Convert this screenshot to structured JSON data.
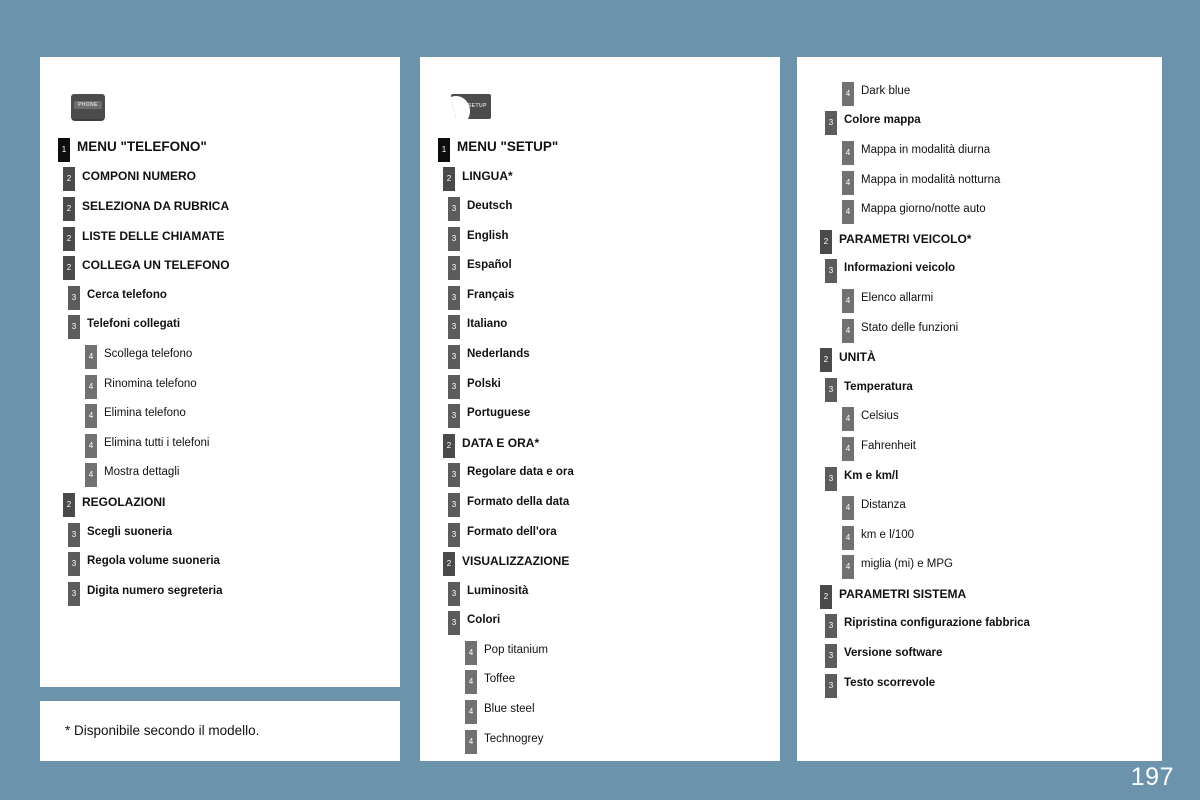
{
  "page": {
    "number": "197",
    "background_color": "#6b93ab"
  },
  "footnote": {
    "text": "* Disponibile secondo il modello."
  },
  "columns": [
    {
      "id": "col1",
      "icon": {
        "name": "phone-icon",
        "label": "PHONE"
      },
      "items": [
        {
          "level": 1,
          "label": "MENU \"TELEFONO\""
        },
        {
          "level": 2,
          "label": "COMPONI NUMERO"
        },
        {
          "level": 2,
          "label": "SELEZIONA DA RUBRICA"
        },
        {
          "level": 2,
          "label": "LISTE DELLE CHIAMATE"
        },
        {
          "level": 2,
          "label": "COLLEGA UN TELEFONO"
        },
        {
          "level": 3,
          "label": "Cerca telefono"
        },
        {
          "level": 3,
          "label": "Telefoni collegati"
        },
        {
          "level": 4,
          "label": "Scollega telefono"
        },
        {
          "level": 4,
          "label": "Rinomina telefono"
        },
        {
          "level": 4,
          "label": "Elimina telefono"
        },
        {
          "level": 4,
          "label": "Elimina tutti i telefoni"
        },
        {
          "level": 4,
          "label": "Mostra dettagli"
        },
        {
          "level": 2,
          "label": "REGOLAZIONI"
        },
        {
          "level": 3,
          "label": "Scegli suoneria"
        },
        {
          "level": 3,
          "label": "Regola volume suoneria"
        },
        {
          "level": 3,
          "label": "Digita numero segreteria"
        }
      ]
    },
    {
      "id": "col2",
      "icon": {
        "name": "setup-icon",
        "label": "SETUP"
      },
      "items": [
        {
          "level": 1,
          "label": "MENU \"SETUP\""
        },
        {
          "level": 2,
          "label": "LINGUA*"
        },
        {
          "level": 3,
          "label": "Deutsch"
        },
        {
          "level": 3,
          "label": "English"
        },
        {
          "level": 3,
          "label": "Español"
        },
        {
          "level": 3,
          "label": "Français"
        },
        {
          "level": 3,
          "label": "Italiano"
        },
        {
          "level": 3,
          "label": "Nederlands"
        },
        {
          "level": 3,
          "label": "Polski"
        },
        {
          "level": 3,
          "label": "Portuguese"
        },
        {
          "level": 2,
          "label": "DATA E ORA*"
        },
        {
          "level": 3,
          "label": "Regolare data e ora"
        },
        {
          "level": 3,
          "label": "Formato della data"
        },
        {
          "level": 3,
          "label": "Formato dell'ora"
        },
        {
          "level": 2,
          "label": "VISUALIZZAZIONE"
        },
        {
          "level": 3,
          "label": "Luminosità"
        },
        {
          "level": 3,
          "label": "Colori"
        },
        {
          "level": 4,
          "label": "Pop titanium"
        },
        {
          "level": 4,
          "label": "Toffee"
        },
        {
          "level": 4,
          "label": "Blue steel"
        },
        {
          "level": 4,
          "label": "Technogrey"
        }
      ]
    },
    {
      "id": "col3",
      "icon": null,
      "items": [
        {
          "level": 4,
          "label": "Dark blue"
        },
        {
          "level": 3,
          "label": "Colore mappa"
        },
        {
          "level": 4,
          "label": "Mappa in modalità diurna"
        },
        {
          "level": 4,
          "label": "Mappa in modalità notturna"
        },
        {
          "level": 4,
          "label": "Mappa giorno/notte auto"
        },
        {
          "level": 2,
          "label": "PARAMETRI VEICOLO*"
        },
        {
          "level": 3,
          "label": "Informazioni veicolo"
        },
        {
          "level": 4,
          "label": "Elenco allarmi"
        },
        {
          "level": 4,
          "label": "Stato delle funzioni"
        },
        {
          "level": 2,
          "label": "UNITÀ"
        },
        {
          "level": 3,
          "label": "Temperatura"
        },
        {
          "level": 4,
          "label": "Celsius"
        },
        {
          "level": 4,
          "label": "Fahrenheit"
        },
        {
          "level": 3,
          "label": "Km e km/l"
        },
        {
          "level": 4,
          "label": "Distanza"
        },
        {
          "level": 4,
          "label": "km e l/100"
        },
        {
          "level": 4,
          "label": "miglia (mi) e MPG"
        },
        {
          "level": 2,
          "label": "PARAMETRI SISTEMA"
        },
        {
          "level": 3,
          "label": "Ripristina configurazione fabbrica"
        },
        {
          "level": 3,
          "label": "Versione software"
        },
        {
          "level": 3,
          "label": "Testo scorrevole"
        }
      ]
    }
  ]
}
